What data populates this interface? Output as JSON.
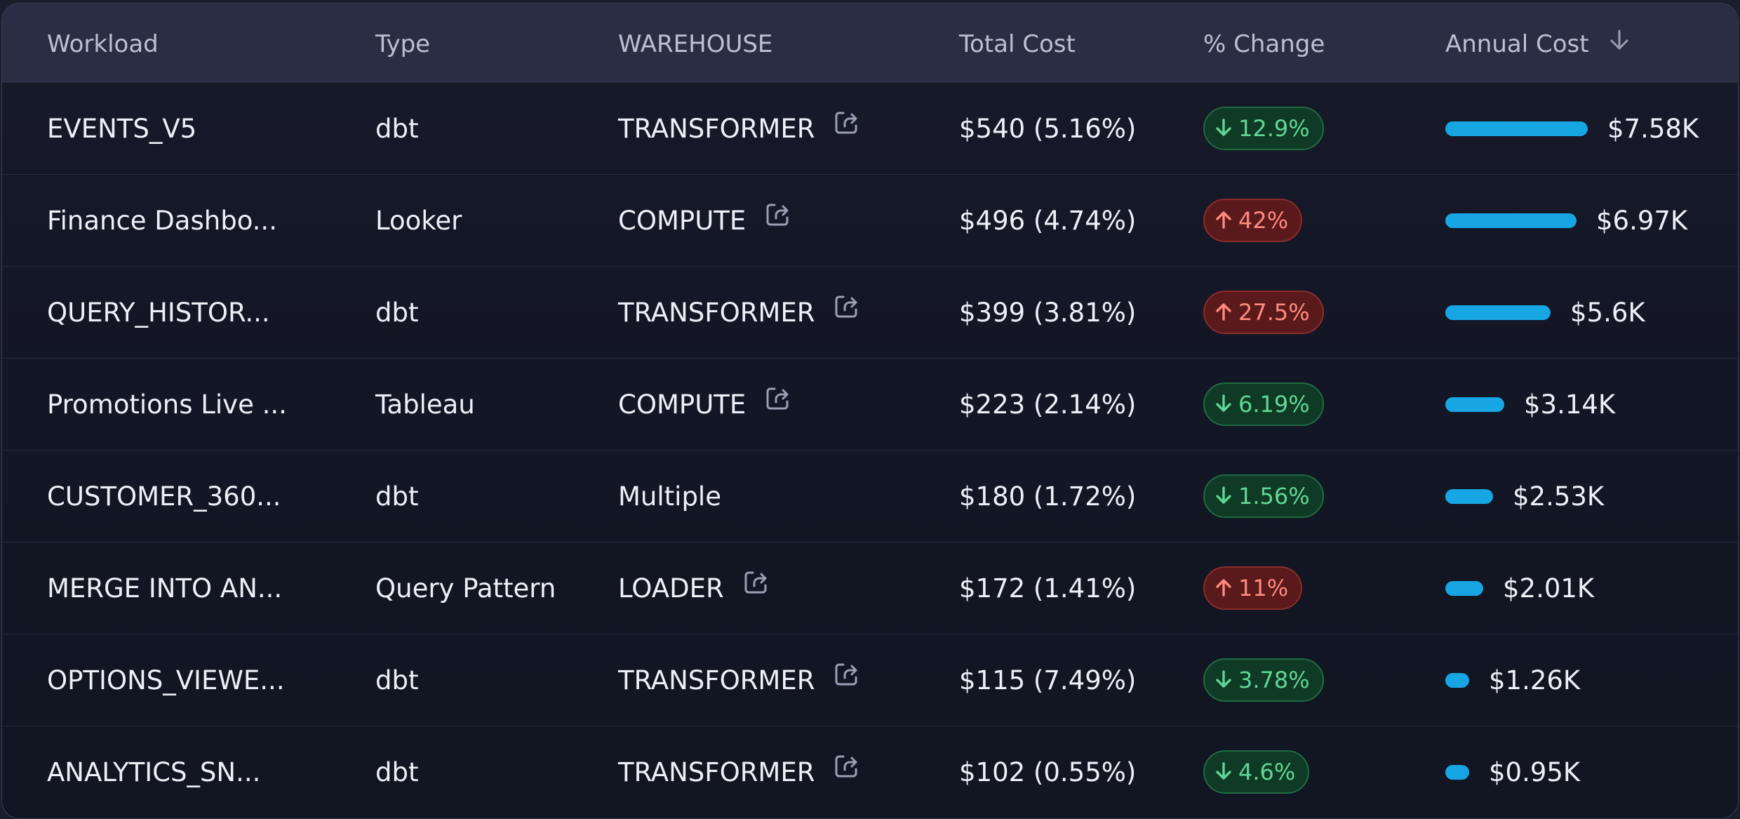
{
  "columns": {
    "workload": "Workload",
    "type": "Type",
    "warehouse": "WAREHOUSE",
    "total_cost": "Total Cost",
    "change": "% Change",
    "annual_cost": "Annual Cost"
  },
  "colors": {
    "bar": "#16a6e3",
    "down_badge_bg": "#0f3a25",
    "down_badge_text": "#5fd794",
    "up_badge_bg": "#5a1a1b",
    "up_badge_text": "#ff8a7c"
  },
  "rows": [
    {
      "workload": "EVENTS_V5",
      "type": "dbt",
      "warehouse": "TRANSFORMER",
      "warehouse_link": true,
      "total_cost": "$540 (5.16%)",
      "change": "12.9%",
      "direction": "down",
      "annual_cost": "$7.58K",
      "annual_value": 7.58
    },
    {
      "workload": "Finance Dashbo...",
      "type": "Looker",
      "warehouse": "COMPUTE",
      "warehouse_link": true,
      "total_cost": "$496 (4.74%)",
      "change": "42%",
      "direction": "up",
      "annual_cost": "$6.97K",
      "annual_value": 6.97
    },
    {
      "workload": "QUERY_HISTOR...",
      "type": "dbt",
      "warehouse": "TRANSFORMER",
      "warehouse_link": true,
      "total_cost": "$399 (3.81%)",
      "change": "27.5%",
      "direction": "up",
      "annual_cost": "$5.6K",
      "annual_value": 5.6
    },
    {
      "workload": "Promotions Live ...",
      "type": "Tableau",
      "warehouse": "COMPUTE",
      "warehouse_link": true,
      "total_cost": "$223 (2.14%)",
      "change": "6.19%",
      "direction": "down",
      "annual_cost": "$3.14K",
      "annual_value": 3.14
    },
    {
      "workload": "CUSTOMER_360...",
      "type": "dbt",
      "warehouse": "Multiple",
      "warehouse_link": false,
      "total_cost": "$180 (1.72%)",
      "change": "1.56%",
      "direction": "down",
      "annual_cost": "$2.53K",
      "annual_value": 2.53
    },
    {
      "workload": "MERGE INTO AN...",
      "type": "Query Pattern",
      "warehouse": "LOADER",
      "warehouse_link": true,
      "total_cost": "$172 (1.41%)",
      "change": "11%",
      "direction": "up",
      "annual_cost": "$2.01K",
      "annual_value": 2.01
    },
    {
      "workload": "OPTIONS_VIEWE...",
      "type": "dbt",
      "warehouse": "TRANSFORMER",
      "warehouse_link": true,
      "total_cost": "$115 (7.49%)",
      "change": "3.78%",
      "direction": "down",
      "annual_cost": "$1.26K",
      "annual_value": 1.26
    },
    {
      "workload": "ANALYTICS_SN...",
      "type": "dbt",
      "warehouse": "TRANSFORMER",
      "warehouse_link": true,
      "total_cost": "$102 (0.55%)",
      "change": "4.6%",
      "direction": "down",
      "annual_cost": "$0.95K",
      "annual_value": 0.95
    }
  ]
}
